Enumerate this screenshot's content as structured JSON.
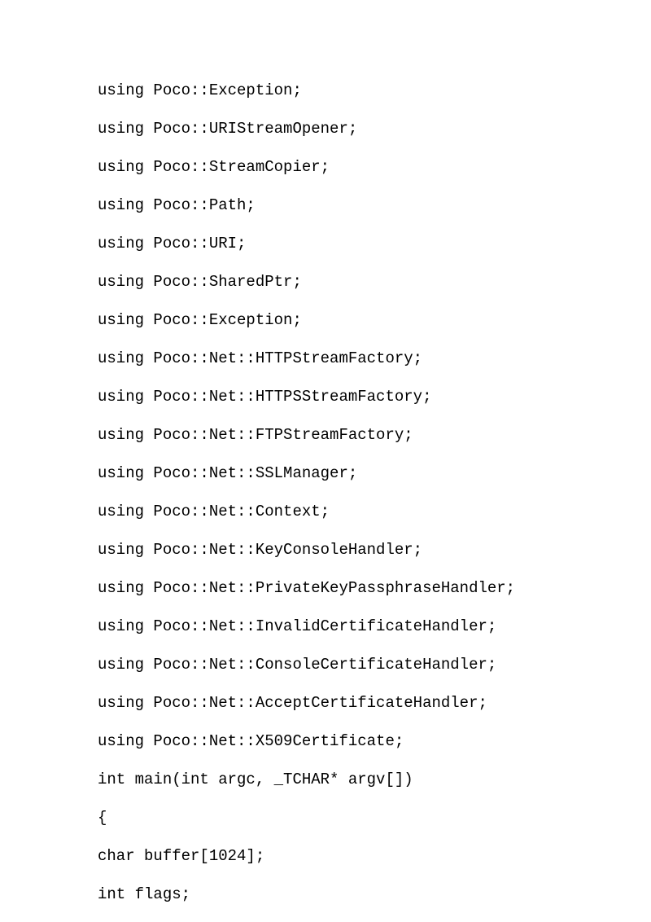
{
  "lines": [
    "using Poco::Exception;",
    "using Poco::URIStreamOpener;",
    "using Poco::StreamCopier;",
    "using Poco::Path;",
    "using Poco::URI;",
    "using Poco::SharedPtr;",
    "using Poco::Exception;",
    "using Poco::Net::HTTPStreamFactory;",
    "using Poco::Net::HTTPSStreamFactory;",
    "using Poco::Net::FTPStreamFactory;",
    "using Poco::Net::SSLManager;",
    "using Poco::Net::Context;",
    "using Poco::Net::KeyConsoleHandler;",
    "using Poco::Net::PrivateKeyPassphraseHandler;",
    "using Poco::Net::InvalidCertificateHandler;",
    "using Poco::Net::ConsoleCertificateHandler;",
    "using Poco::Net::AcceptCertificateHandler;",
    "using Poco::Net::X509Certificate;",
    "int main(int argc, _TCHAR* argv[])",
    "{",
    "char buffer[1024];",
    "int flags;"
  ]
}
